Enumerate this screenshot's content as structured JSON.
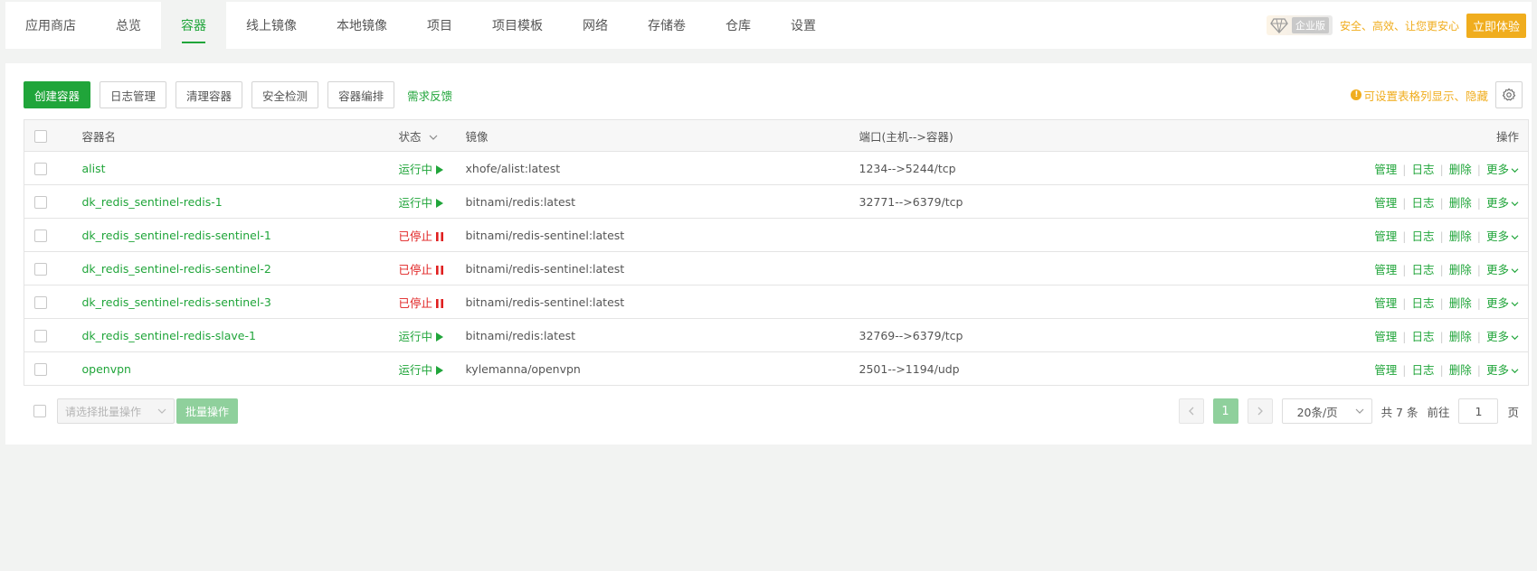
{
  "nav": {
    "tabs": [
      {
        "label": "应用商店"
      },
      {
        "label": "总览"
      },
      {
        "label": "容器",
        "active": true
      },
      {
        "label": "线上镜像"
      },
      {
        "label": "本地镜像"
      },
      {
        "label": "项目"
      },
      {
        "label": "项目模板"
      },
      {
        "label": "网络"
      },
      {
        "label": "存储卷"
      },
      {
        "label": "仓库"
      },
      {
        "label": "设置"
      }
    ],
    "enterprise_label": "企业版",
    "promo_text": "安全、高效、让您更安心",
    "try_label": "立即体验"
  },
  "toolbar": {
    "create": "创建容器",
    "logs": "日志管理",
    "clean": "清理容器",
    "security": "安全检测",
    "orchestrate": "容器编排",
    "feedback": "需求反馈",
    "hint_text": "可设置表格列显示、隐藏"
  },
  "table": {
    "headers": {
      "name": "容器名",
      "status": "状态",
      "image": "镜像",
      "ports": "端口(主机-->容器)",
      "actions": "操作"
    },
    "rows": [
      {
        "name": "alist",
        "status": "运行中",
        "state": "run",
        "image": "xhofe/alist:latest",
        "ports": "1234-->5244/tcp"
      },
      {
        "name": "dk_redis_sentinel-redis-1",
        "status": "运行中",
        "state": "run",
        "image": "bitnami/redis:latest",
        "ports": "32771-->6379/tcp"
      },
      {
        "name": "dk_redis_sentinel-redis-sentinel-1",
        "status": "已停止",
        "state": "stop",
        "image": "bitnami/redis-sentinel:latest",
        "ports": ""
      },
      {
        "name": "dk_redis_sentinel-redis-sentinel-2",
        "status": "已停止",
        "state": "stop",
        "image": "bitnami/redis-sentinel:latest",
        "ports": ""
      },
      {
        "name": "dk_redis_sentinel-redis-sentinel-3",
        "status": "已停止",
        "state": "stop",
        "image": "bitnami/redis-sentinel:latest",
        "ports": ""
      },
      {
        "name": "dk_redis_sentinel-redis-slave-1",
        "status": "运行中",
        "state": "run",
        "image": "bitnami/redis:latest",
        "ports": "32769-->6379/tcp"
      },
      {
        "name": "openvpn",
        "status": "运行中",
        "state": "run",
        "image": "kylemanna/openvpn",
        "ports": "2501-->1194/udp"
      }
    ],
    "actions": {
      "manage": "管理",
      "log": "日志",
      "delete": "删除",
      "more": "更多"
    }
  },
  "footer": {
    "batch_placeholder": "请选择批量操作",
    "batch_button": "批量操作",
    "current_page": "1",
    "page_size": "20条/页",
    "total": "共 7 条",
    "goto_prefix": "前往",
    "goto_value": "1",
    "goto_suffix": "页"
  },
  "colors": {
    "accent": "#20a53a",
    "stopped": "#e02020",
    "warning": "#f0ad1e"
  }
}
